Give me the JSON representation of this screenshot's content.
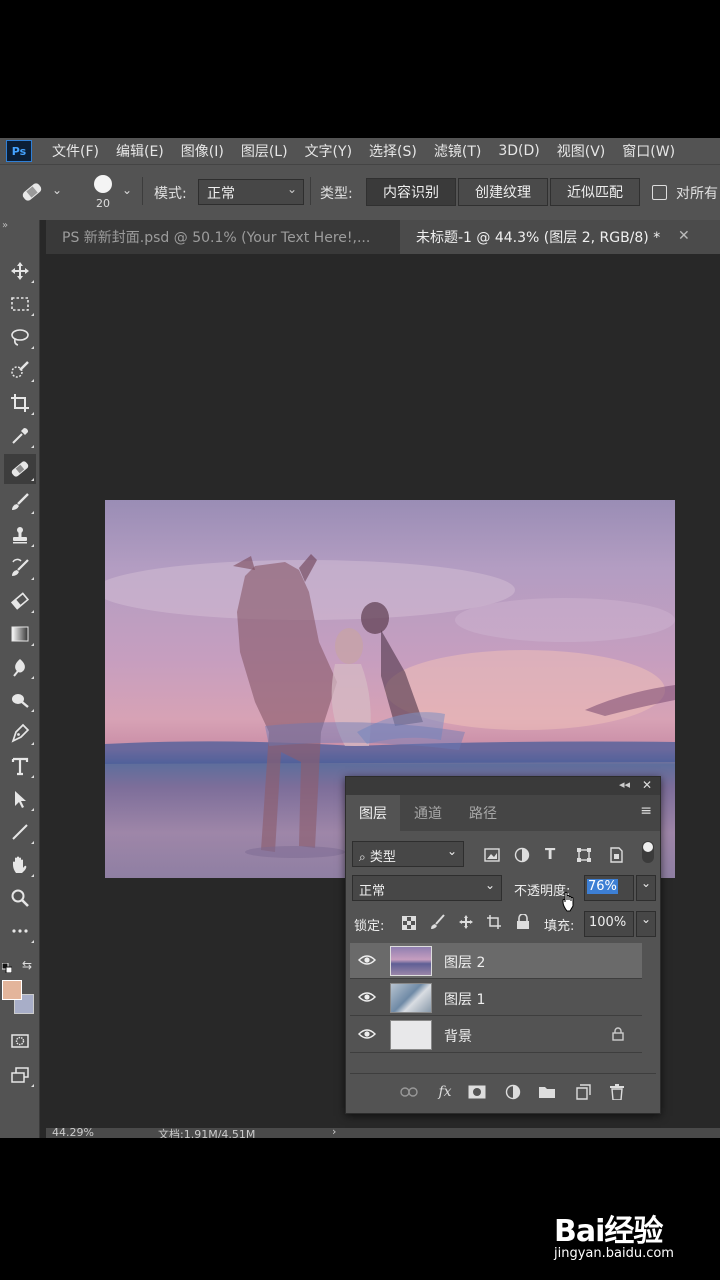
{
  "app": {
    "logo": "Ps"
  },
  "menu": [
    "文件(F)",
    "编辑(E)",
    "图像(I)",
    "图层(L)",
    "文字(Y)",
    "选择(S)",
    "滤镜(T)",
    "3D(D)",
    "视图(V)",
    "窗口(W)"
  ],
  "options": {
    "brush_size": "20",
    "mode_label": "模式:",
    "mode_value": "正常",
    "type_label": "类型:",
    "type_buttons": [
      "内容识别",
      "创建纹理",
      "近似匹配"
    ],
    "sample_all_label": "对所有"
  },
  "tabs": [
    {
      "label": "PS 新新封面.psd @ 50.1% (Your Text Here!,..."
    },
    {
      "label": "未标题-1 @ 44.3% (图层 2, RGB/8) *"
    }
  ],
  "tools": [
    "move-tool",
    "marquee-tool",
    "lasso-tool",
    "quick-selection-tool",
    "crop-tool",
    "eyedropper-tool",
    "spot-healing-tool",
    "brush-tool",
    "clone-stamp-tool",
    "history-brush-tool",
    "eraser-tool",
    "gradient-tool",
    "blur-tool",
    "dodge-tool",
    "pen-tool",
    "type-tool",
    "path-selection-tool",
    "line-tool",
    "hand-tool",
    "zoom-tool",
    "more-tools"
  ],
  "colors": {
    "foreground": "#e3b59b",
    "background": "#a8aec8",
    "accent": "#2f7fd6"
  },
  "layers_panel": {
    "tabs": [
      "图层",
      "通道",
      "路径"
    ],
    "filter_kind": "类型",
    "blend_mode": "正常",
    "opacity_label": "不透明度:",
    "opacity_value": "76%",
    "lock_label": "锁定:",
    "fill_label": "填充:",
    "fill_value": "100%",
    "layers": [
      {
        "name": "图层 2",
        "selected": true
      },
      {
        "name": "图层 1",
        "selected": false
      },
      {
        "name": "背景",
        "selected": false,
        "locked": true
      }
    ]
  },
  "status": {
    "zoom": "44.29%",
    "doc": "文档:1.91M/4.51M"
  },
  "watermark": {
    "logo": "Bai经验",
    "url": "jingyan.baidu.com"
  }
}
